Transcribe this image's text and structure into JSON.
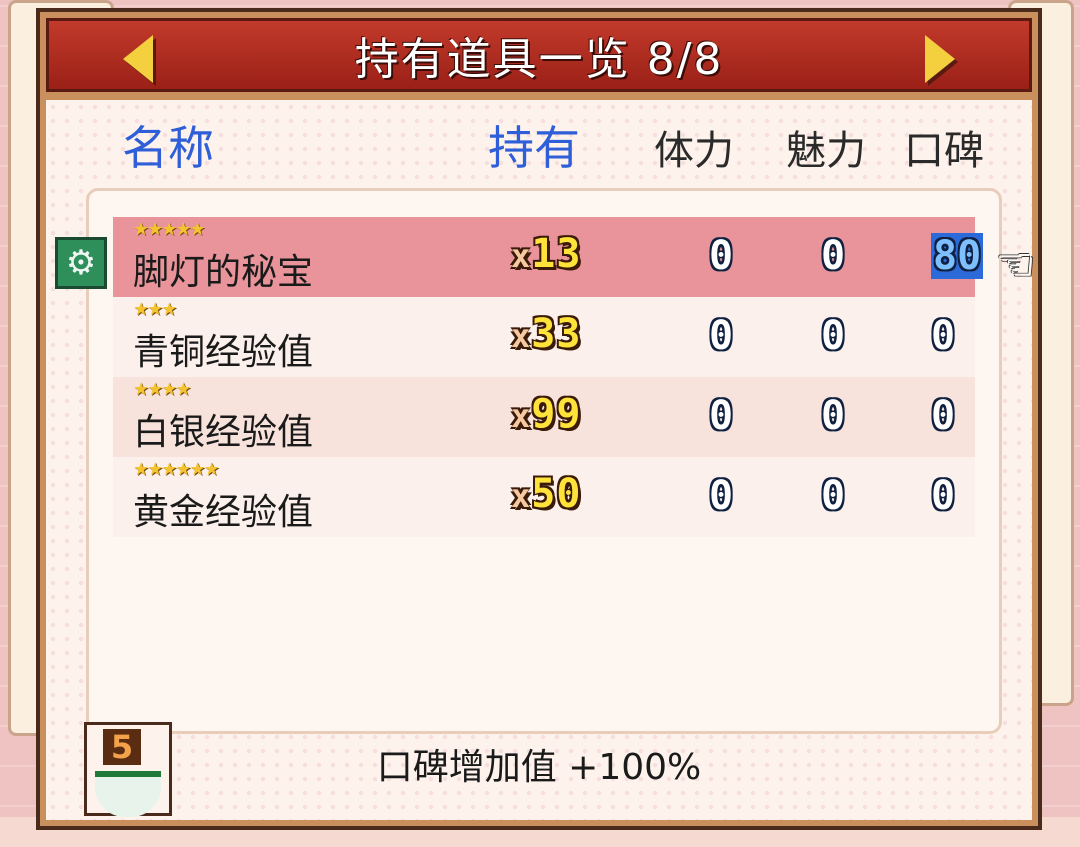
{
  "window": {
    "title": "持有道具一览 8/8"
  },
  "columns": {
    "name": "名称",
    "hold": "持有",
    "stamina": "体力",
    "charm": "魅力",
    "reputation": "口碑"
  },
  "items": [
    {
      "stars": "★★★★★",
      "name": "脚灯的秘宝",
      "count_prefix": "x",
      "count": "13",
      "stamina": "0",
      "charm": "0",
      "reputation": "80",
      "selected": true
    },
    {
      "stars": "★★★",
      "name": "青铜经验值",
      "count_prefix": "x",
      "count": "33",
      "stamina": "0",
      "charm": "0",
      "reputation": "0"
    },
    {
      "stars": "★★★★",
      "name": "白银经验值",
      "count_prefix": "x",
      "count": "99",
      "stamina": "0",
      "charm": "0",
      "reputation": "0"
    },
    {
      "stars": "★★★★★★",
      "name": "黄金经验值",
      "count_prefix": "x",
      "count": "50",
      "stamina": "0",
      "charm": "0",
      "reputation": "0"
    }
  ],
  "footer": {
    "badge_number": "5",
    "bonus_text": "口碑增加值 +100%"
  },
  "icons": {
    "prev": "left-arrow-icon",
    "next": "right-arrow-icon",
    "gear": "gear-icon",
    "cursor": "pointing-hand-icon",
    "scale": "scale-icon"
  }
}
